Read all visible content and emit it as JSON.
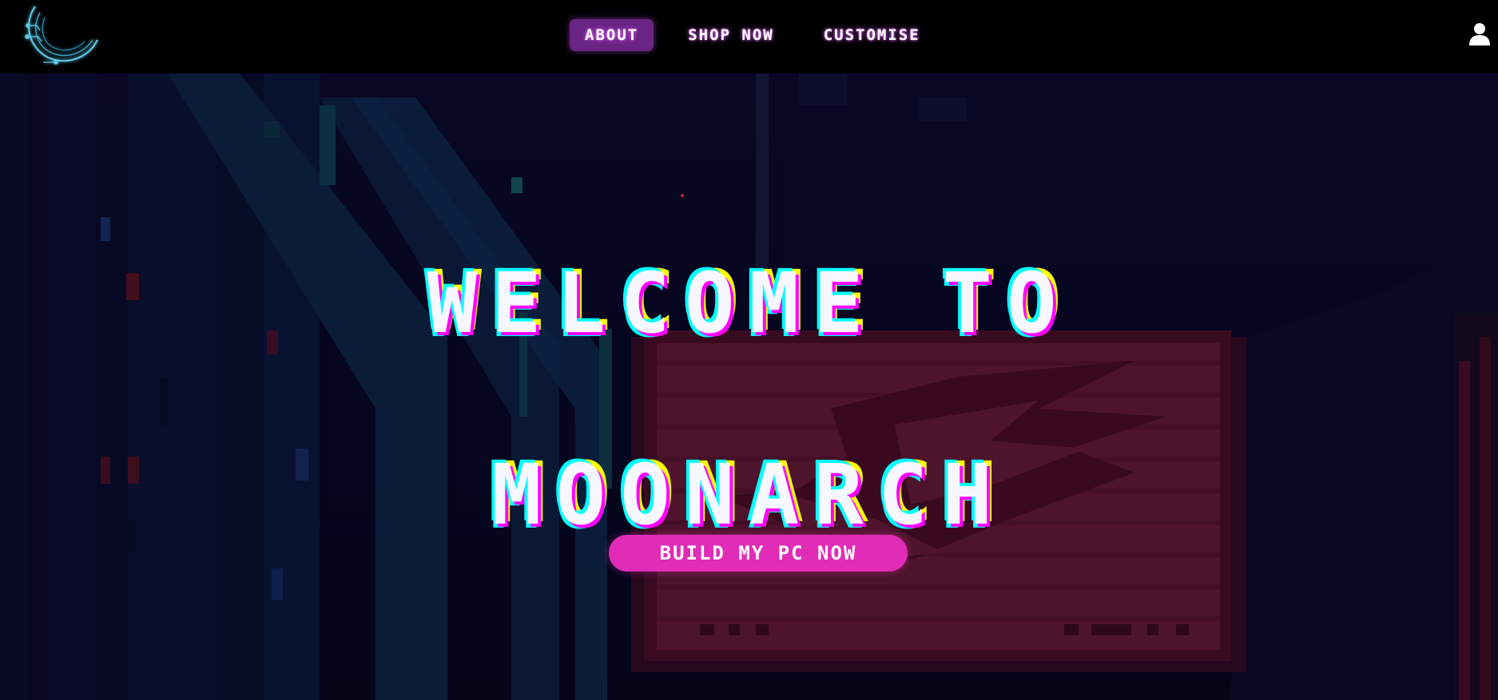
{
  "nav": {
    "links": [
      {
        "label": "ABOUT",
        "active": true
      },
      {
        "label": "SHOP NOW",
        "active": false
      },
      {
        "label": "CUSTOMISE",
        "active": false
      }
    ],
    "logo_icon": "crescent-moon-circuit-icon",
    "user_icon": "user-icon"
  },
  "hero": {
    "title_line1": "WELCOME TO",
    "title_line2": "MOONARCH",
    "cta_label": "BUILD MY PC NOW"
  },
  "colors": {
    "nav_bg": "#000000",
    "active_tab": "#6a2483",
    "cta": "#e02cb7",
    "title_glitch_cyan": "#00ffff",
    "title_glitch_magenta": "#ff00ff",
    "title_glitch_yellow": "#ffff00",
    "background": "#070722",
    "sign_red": "#6e0f2e"
  }
}
